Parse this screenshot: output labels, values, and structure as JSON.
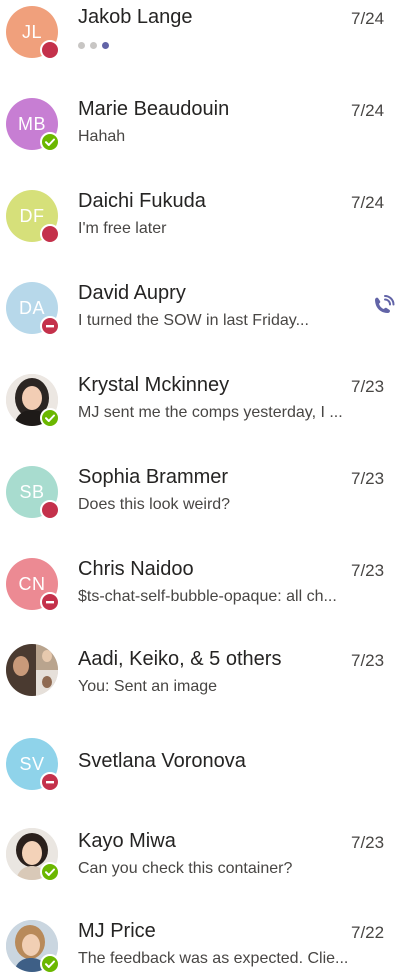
{
  "colors": {
    "available": "#6bb700",
    "busy": "#c4314b",
    "dnd": "#c4314b",
    "accent": "#6264a7"
  },
  "chats": [
    {
      "name": "Jakob Lange",
      "initials": "JL",
      "avatar_color": "#f0a07c",
      "status": "busy",
      "time": "7/24",
      "preview": "",
      "typing": true
    },
    {
      "name": "Marie Beaudouin",
      "initials": "MB",
      "avatar_color": "#c77ed3",
      "status": "available",
      "time": "7/24",
      "preview": "Hahah"
    },
    {
      "name": "Daichi Fukuda",
      "initials": "DF",
      "avatar_color": "#d6e07a",
      "status": "busy",
      "time": "7/24",
      "preview": "I'm free later"
    },
    {
      "name": "David Aupry",
      "initials": "DA",
      "avatar_color": "#b7d8ea",
      "status": "dnd",
      "time": "",
      "preview": "I turned the SOW in last Friday...",
      "call_icon": "phone-call-icon"
    },
    {
      "name": "Krystal Mckinney",
      "initials": "",
      "avatar_photo": true,
      "status": "available",
      "time": "7/23",
      "preview": "MJ sent me the comps yesterday, I ..."
    },
    {
      "name": "Sophia Brammer",
      "initials": "SB",
      "avatar_color": "#a8dccf",
      "status": "busy",
      "time": "7/23",
      "preview": "Does this look weird?"
    },
    {
      "name": "Chris Naidoo",
      "initials": "CN",
      "avatar_color": "#ec8a93",
      "status": "dnd",
      "time": "7/23",
      "preview": "$ts-chat-self-bubble-opaque: all ch..."
    },
    {
      "name": "Aadi, Keiko, & 5 others",
      "initials": "",
      "avatar_photo": true,
      "status": "",
      "time": "7/23",
      "preview": "You: Sent an image"
    },
    {
      "name": "Svetlana Voronova",
      "initials": "SV",
      "avatar_color": "#8fd3ea",
      "status": "dnd",
      "time": "",
      "preview": ""
    },
    {
      "name": "Kayo Miwa",
      "initials": "",
      "avatar_photo": true,
      "status": "available",
      "time": "7/23",
      "preview": "Can you check this container?"
    },
    {
      "name": "MJ Price",
      "initials": "",
      "avatar_photo": true,
      "status": "available",
      "time": "7/22",
      "preview": "The feedback was as expected. Clie..."
    }
  ]
}
